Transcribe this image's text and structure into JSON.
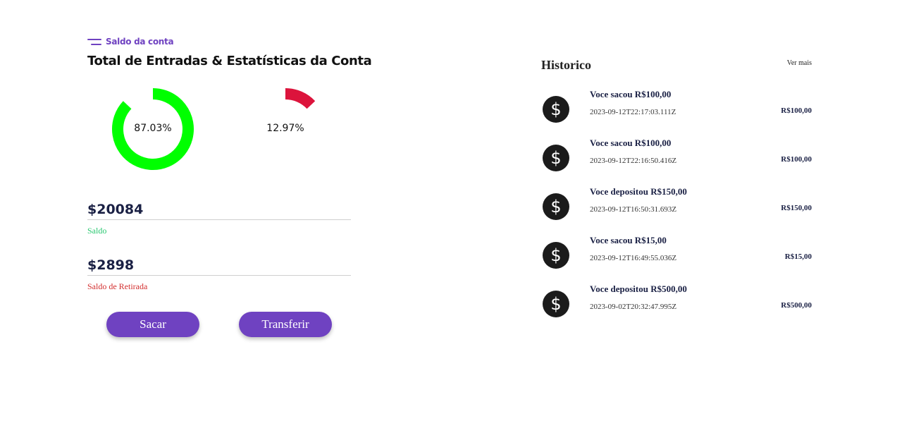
{
  "account": {
    "eyebrow": "Saldo da conta",
    "title": "Total de Entradas & Estatísticas da Conta"
  },
  "chart_data": [
    {
      "type": "pie",
      "values": [
        87.03
      ],
      "labels": [
        "87.03%"
      ],
      "color": "#00ff00"
    },
    {
      "type": "pie",
      "values": [
        12.97
      ],
      "labels": [
        "12.97%"
      ],
      "color": "#dc143c"
    }
  ],
  "stats": [
    {
      "value": "$20084",
      "caption": "Saldo",
      "caption_color": "#28c76f"
    },
    {
      "value": "$2898",
      "caption": "Saldo de Retirada",
      "caption_color": "#d32f2f"
    }
  ],
  "buttons": {
    "withdraw": "Sacar",
    "transfer": "Transferir"
  },
  "history": {
    "title": "Historico",
    "see_more": "Ver mais",
    "icon": "dollar-coin-icon",
    "items": [
      {
        "title": "Voce sacou R$100,00",
        "date": "2023-09-12T22:17:03.111Z",
        "amount": "R$100,00"
      },
      {
        "title": "Voce sacou R$100,00",
        "date": "2023-09-12T22:16:50.416Z",
        "amount": "R$100,00"
      },
      {
        "title": "Voce depositou R$150,00",
        "date": "2023-09-12T16:50:31.693Z",
        "amount": "R$150,00"
      },
      {
        "title": "Voce sacou R$15,00",
        "date": "2023-09-12T16:49:55.036Z",
        "amount": "R$15,00"
      },
      {
        "title": "Voce depositou R$500,00",
        "date": "2023-09-02T20:32:47.995Z",
        "amount": "R$500,00"
      }
    ]
  }
}
